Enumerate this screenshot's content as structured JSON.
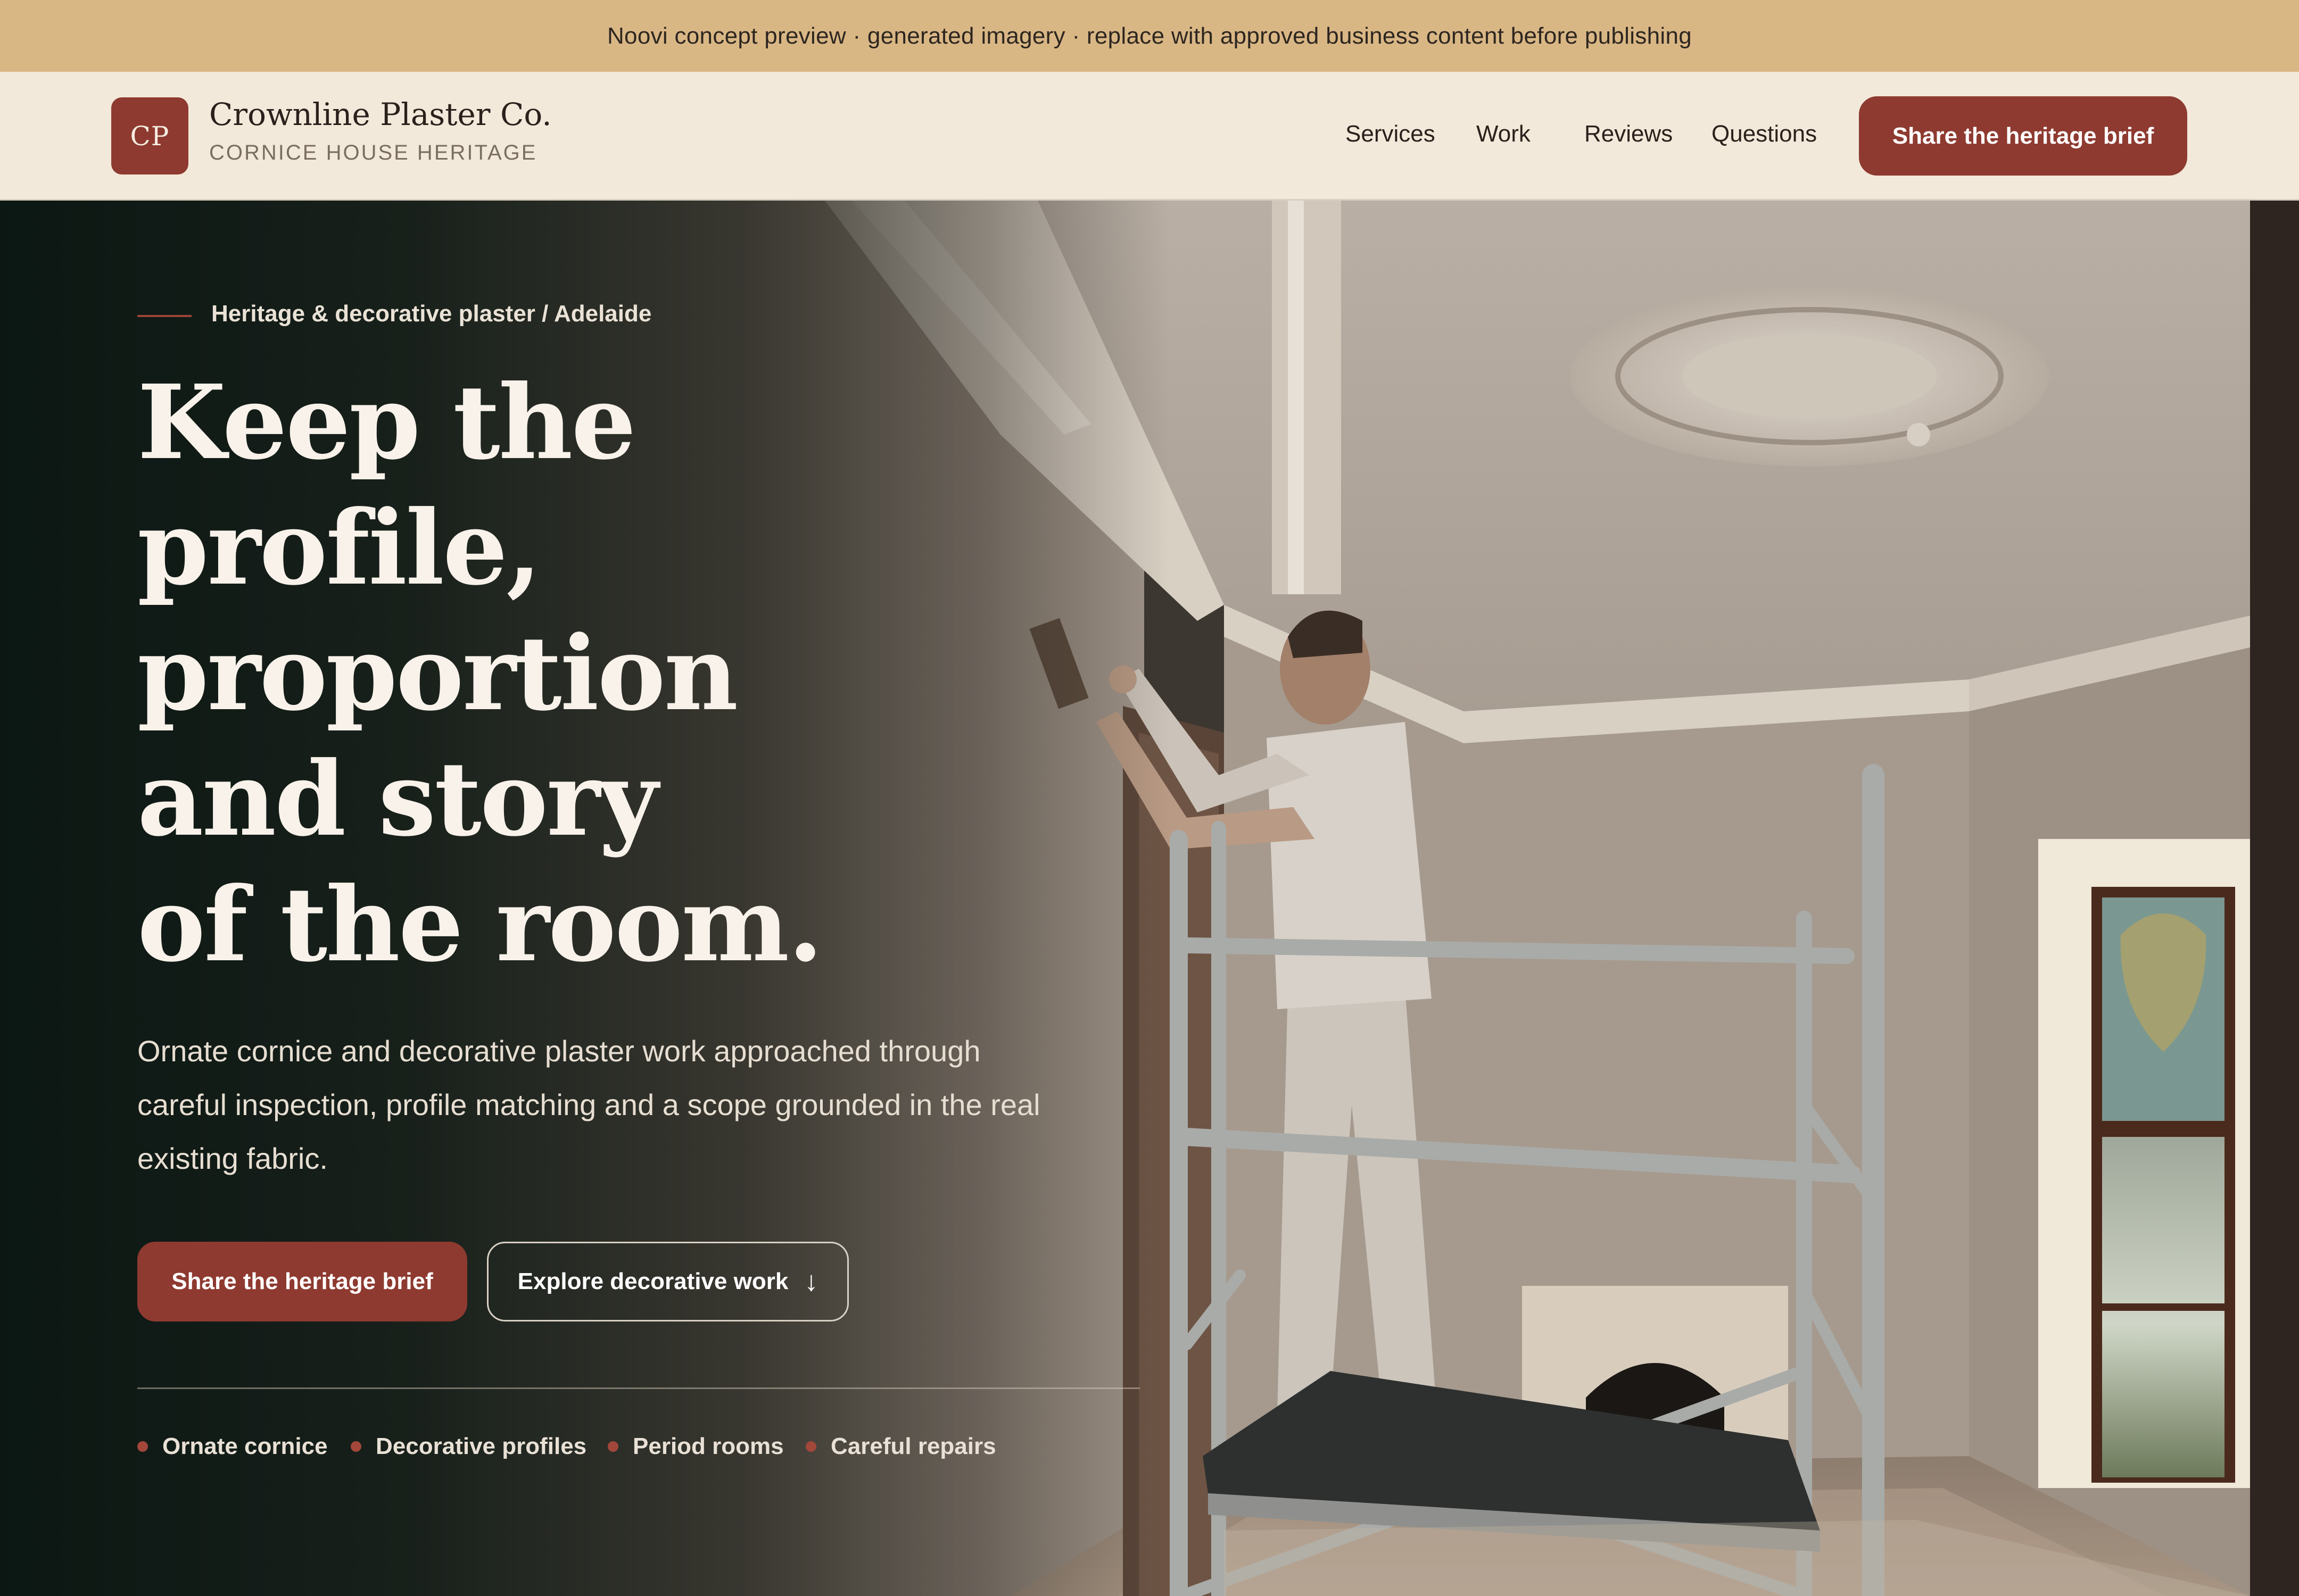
{
  "notice": {
    "text": "Noovi concept preview · generated imagery · replace with approved business content before publishing"
  },
  "header": {
    "logo_initials": "CP",
    "brand_name": "Crownline Plaster Co.",
    "brand_tagline": "CORNICE HOUSE HERITAGE",
    "nav": [
      "Services",
      "Work",
      "Reviews",
      "Questions"
    ],
    "cta_label": "Share the heritage brief"
  },
  "hero": {
    "eyebrow": "Heritage & decorative plaster / Adelaide",
    "headline_lines": [
      "Keep the",
      "profile,",
      "proportion",
      "and story",
      "of the room."
    ],
    "lead_lines": [
      "Ornate cornice and decorative plaster work approached through",
      "careful inspection, profile matching and a scope grounded in the real",
      "existing fabric."
    ],
    "primary_cta": "Share the heritage brief",
    "secondary_cta": "Explore decorative work",
    "secondary_cta_icon": "↓",
    "tags": [
      "Ornate cornice",
      "Decorative profiles",
      "Period rooms",
      "Careful repairs"
    ]
  },
  "colors": {
    "notice_bg": "#d9b785",
    "header_bg": "#f3e9da",
    "accent": "#8e3a30",
    "hero_dark": "#0e1a15"
  }
}
